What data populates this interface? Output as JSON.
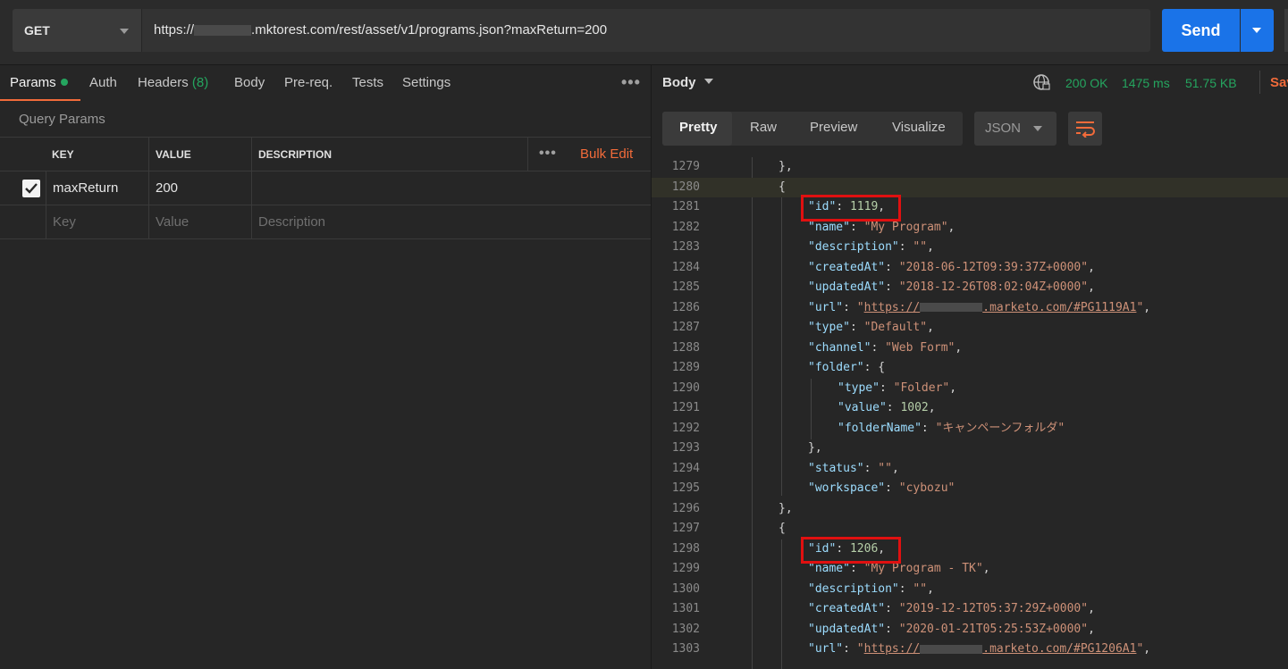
{
  "request": {
    "method": "GET",
    "url_prefix": "https://",
    "url_suffix": ".mktorest.com/rest/asset/v1/programs.json?maxReturn=200",
    "send_label": "Send"
  },
  "left_tabs": {
    "params": "Params",
    "auth": "Auth",
    "headers": "Headers",
    "headers_count": "(8)",
    "body": "Body",
    "prereq": "Pre-req.",
    "tests": "Tests",
    "settings": "Settings"
  },
  "query_params": {
    "title": "Query Params",
    "headers": {
      "key": "KEY",
      "value": "VALUE",
      "description": "DESCRIPTION"
    },
    "bulk_edit": "Bulk Edit",
    "rows": [
      {
        "key": "maxReturn",
        "value": "200",
        "checked": true
      }
    ],
    "placeholders": {
      "key": "Key",
      "value": "Value",
      "description": "Description"
    }
  },
  "response": {
    "body_label": "Body",
    "status": "200 OK",
    "time": "1475 ms",
    "size": "51.75 KB",
    "save_label": "Save",
    "view_tabs": [
      "Pretty",
      "Raw",
      "Preview",
      "Visualize"
    ],
    "active_view": "Pretty",
    "format": "JSON"
  },
  "code_lines": [
    {
      "n": "1279",
      "t": "},"
    },
    {
      "n": "1280",
      "t": "{"
    },
    {
      "n": "1281",
      "t": "\"id\": 1119,"
    },
    {
      "n": "1282",
      "t": "\"name\": \"My Program\","
    },
    {
      "n": "1283",
      "t": "\"description\": \"\","
    },
    {
      "n": "1284",
      "t": "\"createdAt\": \"2018-06-12T09:39:37Z+0000\","
    },
    {
      "n": "1285",
      "t": "\"updatedAt\": \"2018-12-26T08:02:04Z+0000\","
    },
    {
      "n": "1286",
      "t": "\"url\": \"https://.marketo.com/#PG1119A1\","
    },
    {
      "n": "1287",
      "t": "\"type\": \"Default\","
    },
    {
      "n": "1288",
      "t": "\"channel\": \"Web Form\","
    },
    {
      "n": "1289",
      "t": "\"folder\": {"
    },
    {
      "n": "1290",
      "t": "\"type\": \"Folder\","
    },
    {
      "n": "1291",
      "t": "\"value\": 1002,"
    },
    {
      "n": "1292",
      "t": "\"folderName\": \"キャンペーンフォルダ\""
    },
    {
      "n": "1293",
      "t": "},"
    },
    {
      "n": "1294",
      "t": "\"status\": \"\","
    },
    {
      "n": "1295",
      "t": "\"workspace\": \"cybozu\""
    },
    {
      "n": "1296",
      "t": "},"
    },
    {
      "n": "1297",
      "t": "{"
    },
    {
      "n": "1298",
      "t": "\"id\": 1206,"
    },
    {
      "n": "1299",
      "t": "\"name\": \"My Program - TK\","
    },
    {
      "n": "1300",
      "t": "\"description\": \"\","
    },
    {
      "n": "1301",
      "t": "\"createdAt\": \"2019-12-12T05:37:29Z+0000\","
    },
    {
      "n": "1302",
      "t": "\"updatedAt\": \"2020-01-21T05:25:53Z+0000\","
    },
    {
      "n": "1303",
      "t": "\"url\": \"https://.marketo.com/#PG1206A1\","
    }
  ],
  "colors": {
    "accent_orange": "#f26b3a",
    "send_blue": "#1a73e8",
    "status_green": "#25a55f",
    "highlight_red": "#e01010"
  }
}
